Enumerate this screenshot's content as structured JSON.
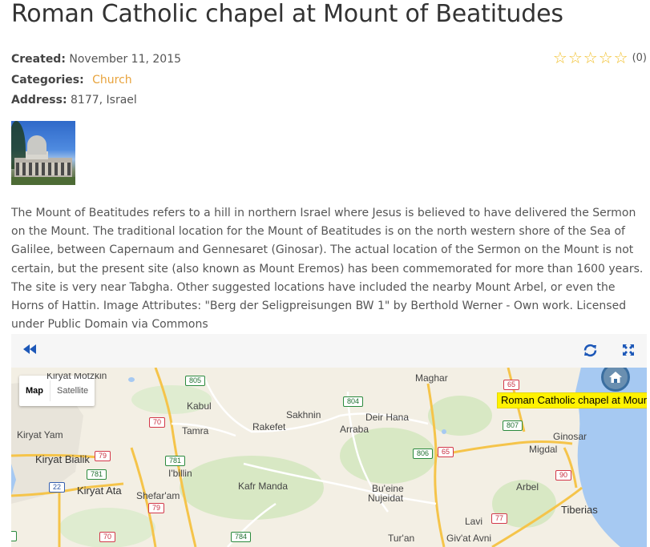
{
  "page": {
    "title": "Roman Catholic chapel at Mount of Beatitudes"
  },
  "meta": {
    "created_label": "Created:",
    "created_value": "November 11, 2015",
    "categories_label": "Categories:",
    "category": "Church",
    "address_label": "Address:",
    "address_value": "8177, Israel"
  },
  "rating": {
    "stars_filled": 0,
    "stars_total": 5,
    "count": "(0)",
    "star_color": "#f2c12e"
  },
  "description": "The Mount of Beatitudes refers to a hill in northern Israel where Jesus is believed to have delivered the Sermon on the Mount. The traditional location for the Mount of Beatitudes is on the north western shore of the Sea of Galilee, between Capernaum and Gennesaret (Ginosar). The actual location of the Sermon on the Mount is not certain, but the present site (also known as Mount Eremos) has been commemorated for more than 1600 years. The site is very near Tabgha. Other suggested locations have included the nearby Mount Arbel, or even the Horns of Hattin. Image Attributes: \"Berg der Seligpreisungen BW 1\" by Berthold Werner - Own work. Licensed under Public Domain via Commons",
  "map_toolbar": {
    "back_icon": "rewind-icon",
    "refresh_icon": "refresh-icon",
    "fullscreen_icon": "fullscreen-icon",
    "icon_color": "#1d58b8"
  },
  "map": {
    "type_map": "Map",
    "type_satellite": "Satellite",
    "poi_label": "Roman Catholic chapel at Moun",
    "places": {
      "kiryat_motzkin": "Kiryat Motzkin",
      "kabul": "Kabul",
      "sakhnin": "Sakhnin",
      "deir_hana": "Deir Hana",
      "maghar": "Maghar",
      "kiryat_yam": "Kiryat Yam",
      "tamra": "Tamra",
      "rakefet": "Rakefet",
      "arraba": "Arraba",
      "ginosar": "Ginosar",
      "migdal": "Migdal",
      "kiryat_bialik": "Kiryat Bialik",
      "ibillin": "I'billin",
      "kiryat_ata": "Kiryat Ata",
      "shefaram": "Shefar'am",
      "kafr_manda": "Kafr Manda",
      "bueine": "Bu'eine",
      "nujeidat": "Nujeidat",
      "arbel": "Arbel",
      "tiberias": "Tiberias",
      "lavi": "Lavi",
      "turan": "Tur'an",
      "givat_avni": "Giv'at Avni"
    },
    "shields": {
      "r805": "805",
      "r804": "804",
      "r65a": "65",
      "r70a": "70",
      "r807": "807",
      "r79a": "79",
      "r781a": "781",
      "r781b": "781",
      "r806": "806",
      "r65b": "65",
      "r22": "22",
      "r90": "90",
      "r79b": "79",
      "r77": "77",
      "r70b": "70",
      "r784": "784"
    },
    "colors": {
      "land": "#f3efe4",
      "water": "#a6c9f2",
      "green": "#d8e8c4",
      "highway": "#f5c44a",
      "road": "#ffffff",
      "poi_label_bg": "#fff200"
    }
  }
}
